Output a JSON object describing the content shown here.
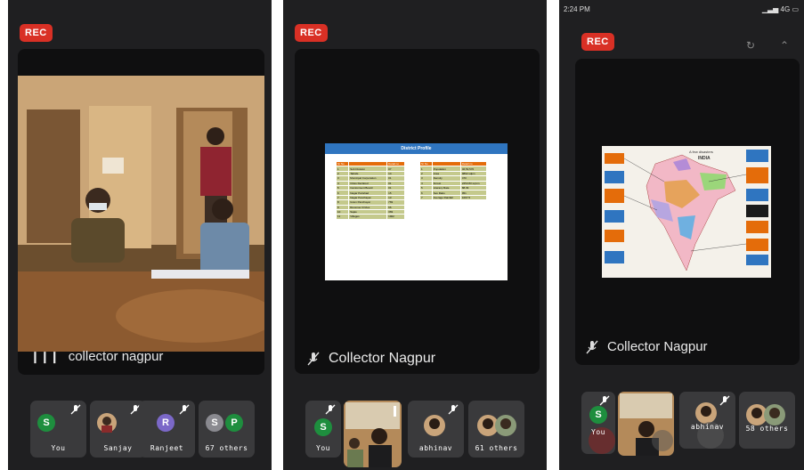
{
  "colors": {
    "rec": "#d93025",
    "green": "#1e8e3e",
    "purple": "#7b68c8",
    "tan": "#c9a47a",
    "dark": "#1f1f21"
  },
  "screens": [
    {
      "rec": "REC",
      "speaker": "collector nagpur",
      "thumbs": [
        {
          "initial": "S",
          "label": "You"
        },
        {
          "label": "Sanjay"
        },
        {
          "initial": "R",
          "label": "Ranjeet"
        },
        {
          "initials": [
            "S",
            "P"
          ],
          "label": "67 others"
        }
      ]
    },
    {
      "rec": "REC",
      "speaker": "Collector Nagpur",
      "slide": {
        "title": "District Profile",
        "left_headers": [
          "Sr No",
          "",
          "Detail no"
        ],
        "left_rows": [
          "Sub Division",
          "Tahsils",
          "Municipal Corporation",
          "Cities Declared",
          "Cantonment Board",
          "Nagar Parishad",
          "Nagar Panchayat",
          "Gram Panchayat",
          "Revenue Circles",
          "Sajas",
          "Villages"
        ],
        "left_vals": [
          "07",
          "14",
          "01",
          "01",
          "01",
          "15",
          "13",
          "769",
          "66",
          "369",
          "1902"
        ],
        "right_headers": [
          "Sr No",
          "",
          "Detail no"
        ],
        "right_rows": [
          "Population",
          "Area",
          "Density",
          "Forest",
          "Literacy Rate",
          "Sex Ratio",
          "Average Rainfall"
        ],
        "right_vals": [
          "46,53,570",
          "9892 sqkm",
          "470",
          "2253.83 sq km",
          "88.39",
          "951",
          "1097.5"
        ]
      },
      "thumbs": [
        {
          "initial": "S",
          "label": "You"
        },
        {
          "label": ""
        },
        {
          "label": "abhinav"
        },
        {
          "label": "61 others"
        }
      ]
    },
    {
      "rec": "REC",
      "speaker": "Collector Nagpur",
      "time": "2:24 PM",
      "signal": "4G",
      "map": {
        "title": "A few disasters",
        "subtitle": "INDIA"
      },
      "thumbs": [
        {
          "initial": "S",
          "label": "You"
        },
        {
          "label": ""
        },
        {
          "label": "abhinav"
        },
        {
          "label": "58 others"
        }
      ]
    }
  ]
}
